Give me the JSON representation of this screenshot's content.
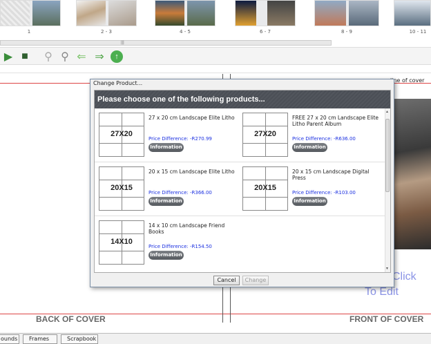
{
  "page_strip": {
    "spreads": [
      {
        "label": "1"
      },
      {
        "label": "2 - 3"
      },
      {
        "label": "4 - 5"
      },
      {
        "label": "6 - 7"
      },
      {
        "label": "8 - 9"
      },
      {
        "label": "10 - 11"
      }
    ]
  },
  "toolbar": {
    "icons": [
      "import-photo-icon",
      "photo-library-icon",
      "zoom-out-icon",
      "zoom-in-icon",
      "arrow-left-icon",
      "arrow-right-icon",
      "go-icon"
    ]
  },
  "canvas": {
    "cover_line_label": "line of cover",
    "back_cover": "BACK OF COVER",
    "front_cover": "FRONT OF COVER",
    "click_to_edit_line1": "Click",
    "click_to_edit_line2": "To Edit"
  },
  "dialog": {
    "title": "Change Product...",
    "header": "Please choose one of the following products...",
    "products": [
      {
        "size": "27X20",
        "name": "27 x 20 cm Landscape Elite Litho",
        "price": "Price Difference: -R270.99",
        "info": "Information"
      },
      {
        "size": "27X20",
        "name": "FREE 27 x 20 cm Landscape Elite Litho Parent Album",
        "price": "Price Difference: -R636.00",
        "info": "Information"
      },
      {
        "size": "20X15",
        "name": "20 x 15 cm Landscape Elite Litho",
        "price": "Price Difference: -R366.00",
        "info": "Information"
      },
      {
        "size": "20X15",
        "name": "20 x 15 cm Landscape Digital Press",
        "price": "Price Difference: -R103.00",
        "info": "Information"
      },
      {
        "size": "14X10",
        "name": "14 x 10 cm Landscape Friend Books",
        "price": "Price Difference: -R154.50",
        "info": "Information"
      }
    ],
    "cancel_label": "Cancel",
    "change_label": "Change"
  },
  "tabs": [
    {
      "label": "ounds"
    },
    {
      "label": "Frames"
    },
    {
      "label": "Scrapbook"
    }
  ],
  "colors": {
    "accent_price": "#1a2fe0",
    "header_bg": "#4b4f56",
    "cover_guide": "#dd4444",
    "click_to_edit": "#8a93e6"
  }
}
